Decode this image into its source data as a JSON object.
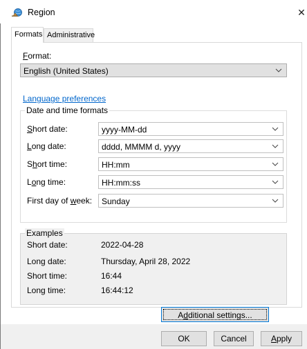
{
  "window": {
    "title": "Region",
    "close_glyph": "✕"
  },
  "tabs": [
    {
      "label": "Formats",
      "active": true
    },
    {
      "label": "Administrative",
      "active": false
    }
  ],
  "format": {
    "label_accel": "F",
    "label_rest": "ormat:",
    "value": "English (United States)"
  },
  "language_preferences_link": "Language preferences",
  "date_time_formats": {
    "legend": "Date and time formats",
    "rows": [
      {
        "label_pre": "",
        "label_accel": "S",
        "label_post": "hort date:",
        "value": "yyyy-MM-dd"
      },
      {
        "label_pre": "",
        "label_accel": "L",
        "label_post": "ong date:",
        "value": "dddd, MMMM d, yyyy"
      },
      {
        "label_pre": "S",
        "label_accel": "h",
        "label_post": "ort time:",
        "value": "HH:mm"
      },
      {
        "label_pre": "L",
        "label_accel": "o",
        "label_post": "ng time:",
        "value": "HH:mm:ss"
      },
      {
        "label_pre": "First day of ",
        "label_accel": "w",
        "label_post": "eek:",
        "value": "Sunday"
      }
    ]
  },
  "examples": {
    "legend": "Examples",
    "rows": [
      {
        "label": "Short date:",
        "value": "2022-04-28"
      },
      {
        "label": "Long date:",
        "value": "Thursday, April 28, 2022"
      },
      {
        "label": "Short time:",
        "value": "16:44"
      },
      {
        "label": "Long time:",
        "value": "16:44:12"
      }
    ]
  },
  "buttons": {
    "additional_settings_pre": "A",
    "additional_settings_accel": "d",
    "additional_settings_post": "ditional settings...",
    "ok": "OK",
    "cancel": "Cancel",
    "apply_accel": "A",
    "apply_rest": "pply"
  },
  "colors": {
    "link": "#0066cc",
    "focus_border": "#0078d7",
    "button_face": "#e1e1e1",
    "dialog_background": "#f0f0f0"
  },
  "icons": {
    "title": "globe-icon",
    "close": "close-icon",
    "dropdown": "chevron-down-icon"
  }
}
